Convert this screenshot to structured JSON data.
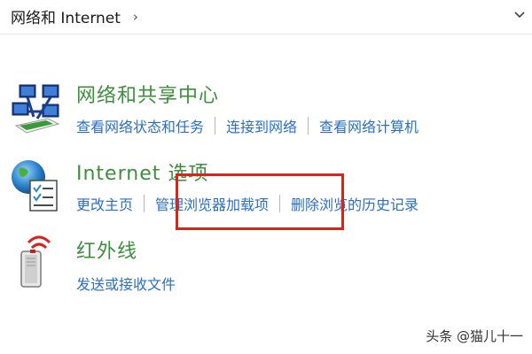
{
  "breadcrumb": {
    "title": "网络和 Internet",
    "separator": "›"
  },
  "categories": {
    "network": {
      "title": "网络和共享中心",
      "links": [
        "查看网络状态和任务",
        "连接到网络",
        "查看网络计算机"
      ]
    },
    "internet": {
      "title": "Internet 选项",
      "links": [
        "更改主页",
        "管理浏览器加载项",
        "删除浏览的历史记录"
      ]
    },
    "infrared": {
      "title": "红外线",
      "links": [
        "发送或接收文件"
      ]
    }
  },
  "watermark": "头条 @猫儿十一",
  "icons": {
    "network": "network-sharing-icon",
    "internet": "internet-options-icon",
    "infrared": "infrared-icon",
    "dropdown": "chevron-down-icon"
  },
  "colors": {
    "category_title": "#3d8f3d",
    "link": "#2a6fc4",
    "highlight": "#d9241c"
  }
}
